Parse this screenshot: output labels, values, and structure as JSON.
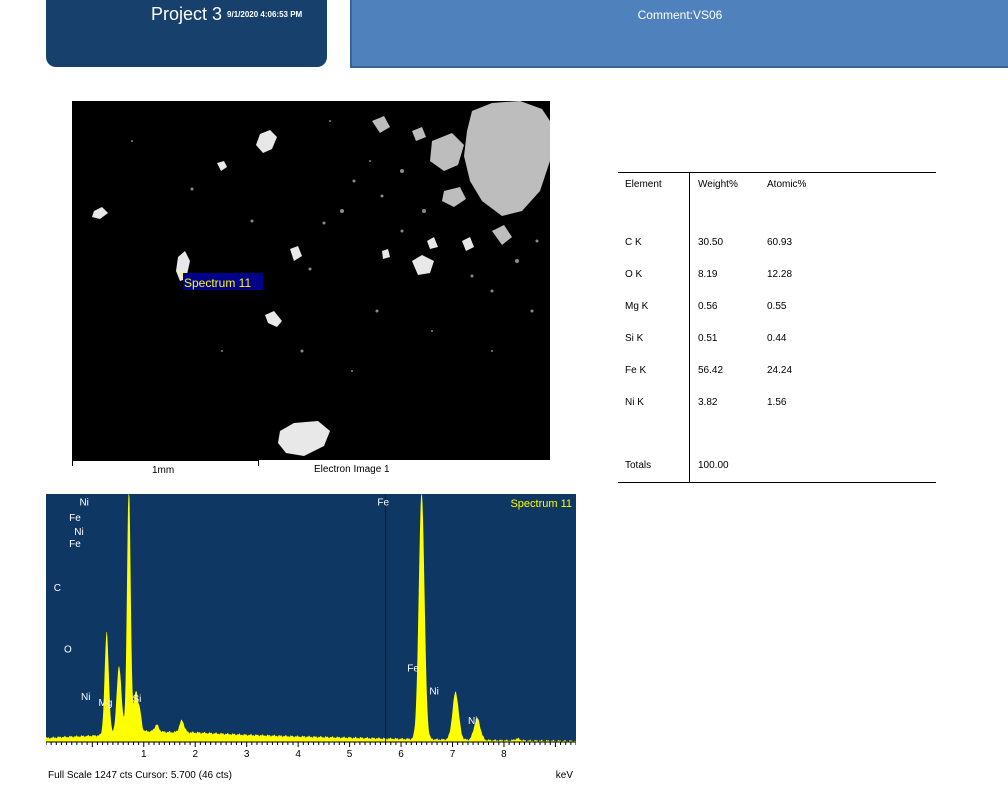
{
  "header": {
    "project": "Project 3",
    "date": "9/1/2020 4:06:53 PM",
    "comment": "Comment:VS06"
  },
  "image": {
    "spectrum_label": "Spectrum 11",
    "scale_label": "1mm",
    "caption": "Electron Image 1"
  },
  "results": {
    "headers": [
      "Element",
      "Weight%",
      "Atomic%"
    ],
    "rows": [
      {
        "element": "C K",
        "weight": "30.50",
        "atomic": "60.93"
      },
      {
        "element": "O K",
        "weight": "8.19",
        "atomic": "12.28"
      },
      {
        "element": "Mg K",
        "weight": "0.56",
        "atomic": "0.55"
      },
      {
        "element": "Si K",
        "weight": "0.51",
        "atomic": "0.44"
      },
      {
        "element": "Fe K",
        "weight": "56.42",
        "atomic": "24.24"
      },
      {
        "element": "Ni K",
        "weight": "3.82",
        "atomic": "1.56"
      }
    ],
    "totals_label": "Totals",
    "totals_weight": "100.00"
  },
  "colors": {
    "header_dark": "#17406d",
    "header_light": "#4f81bd",
    "spectrum_bg": "#0f3764",
    "spectrum_fill": "#ffff00",
    "label_color": "#ffffff"
  },
  "chart_data": {
    "type": "area",
    "title": "Spectrum 11",
    "xlabel": "keV",
    "footer": "Full Scale 1247 cts Cursor: 5.700  (46 cts)",
    "xlim": [
      -0.9,
      9.4
    ],
    "ylim": [
      0,
      1247
    ],
    "cursor_x": 5.7,
    "x_ticks": [
      1,
      2,
      3,
      4,
      5,
      6,
      7,
      8
    ],
    "baseline": [
      [
        -0.9,
        20
      ],
      [
        -0.6,
        25
      ],
      [
        0.3,
        35
      ],
      [
        0.6,
        60
      ],
      [
        1.0,
        55
      ],
      [
        1.5,
        50
      ],
      [
        2.0,
        48
      ],
      [
        3.0,
        36
      ],
      [
        4.0,
        28
      ],
      [
        5.0,
        22
      ],
      [
        6.0,
        16
      ],
      [
        7.0,
        12
      ],
      [
        8.0,
        8
      ],
      [
        9.0,
        6
      ],
      [
        9.4,
        5
      ]
    ],
    "peaks": [
      {
        "x": 0.28,
        "height": 520,
        "width": 0.04
      },
      {
        "x": 0.52,
        "height": 330,
        "width": 0.045
      },
      {
        "x": 0.71,
        "height": 1247,
        "width": 0.035
      },
      {
        "x": 0.85,
        "height": 200,
        "width": 0.04
      },
      {
        "x": 0.93,
        "height": 80,
        "width": 0.03
      },
      {
        "x": 1.25,
        "height": 35,
        "width": 0.04
      },
      {
        "x": 1.74,
        "height": 60,
        "width": 0.045
      },
      {
        "x": 6.4,
        "height": 1247,
        "width": 0.055
      },
      {
        "x": 7.06,
        "height": 240,
        "width": 0.06
      },
      {
        "x": 7.48,
        "height": 110,
        "width": 0.06
      },
      {
        "x": 8.26,
        "height": 10,
        "width": 0.05
      }
    ],
    "labels": [
      {
        "text": "Fe",
        "x": -0.45,
        "y": 1110
      },
      {
        "text": "Ni",
        "x": -0.25,
        "y": 1190
      },
      {
        "text": "Ni",
        "x": -0.35,
        "y": 1040
      },
      {
        "text": "Fe",
        "x": -0.45,
        "y": 980
      },
      {
        "text": "C",
        "x": -0.75,
        "y": 760
      },
      {
        "text": "O",
        "x": -0.55,
        "y": 450
      },
      {
        "text": "Ni",
        "x": -0.22,
        "y": 210
      },
      {
        "text": "Mg",
        "x": 0.12,
        "y": 180
      },
      {
        "text": "Si",
        "x": 0.78,
        "y": 200
      },
      {
        "text": "Fe",
        "x": 5.54,
        "y": 1190
      },
      {
        "text": "Fe",
        "x": 6.12,
        "y": 355
      },
      {
        "text": "Ni",
        "x": 6.55,
        "y": 240
      },
      {
        "text": "Ni",
        "x": 7.3,
        "y": 90
      }
    ]
  }
}
